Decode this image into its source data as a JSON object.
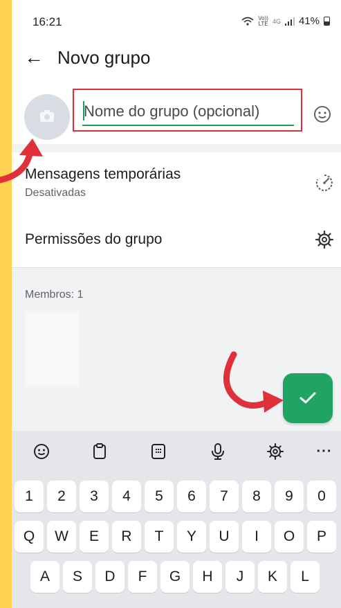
{
  "status_bar": {
    "time": "16:21",
    "net_top": "Vo))",
    "net_bottom": "LTE",
    "net_gen": "4G",
    "battery": "41%"
  },
  "header": {
    "back_icon": "arrow-left-icon",
    "title": "Novo grupo"
  },
  "group_name": {
    "placeholder": "Nome do grupo (opcional)",
    "value": "",
    "accent_color": "#1aa05a",
    "highlight_color": "#e0303a"
  },
  "options": [
    {
      "label": "Mensagens temporárias",
      "sublabel": "Desativadas",
      "icon": "timer-icon"
    },
    {
      "label": "Permissões do grupo",
      "icon": "gear-icon"
    }
  ],
  "members": {
    "label": "Membros: 1"
  },
  "fab": {
    "icon": "check-icon",
    "color": "#1fa463"
  },
  "keyboard": {
    "toolbar": [
      "emoji-icon",
      "clipboard-icon",
      "keypad-icon",
      "mic-icon",
      "settings-icon",
      "more-icon"
    ],
    "row_numbers": [
      "1",
      "2",
      "3",
      "4",
      "5",
      "6",
      "7",
      "8",
      "9",
      "0"
    ],
    "row_top": [
      "Q",
      "W",
      "E",
      "R",
      "T",
      "Y",
      "U",
      "I",
      "O",
      "P"
    ],
    "row_middle": [
      "A",
      "S",
      "D",
      "F",
      "G",
      "H",
      "J",
      "K",
      "L"
    ]
  },
  "annotation_color": "#e0303a"
}
